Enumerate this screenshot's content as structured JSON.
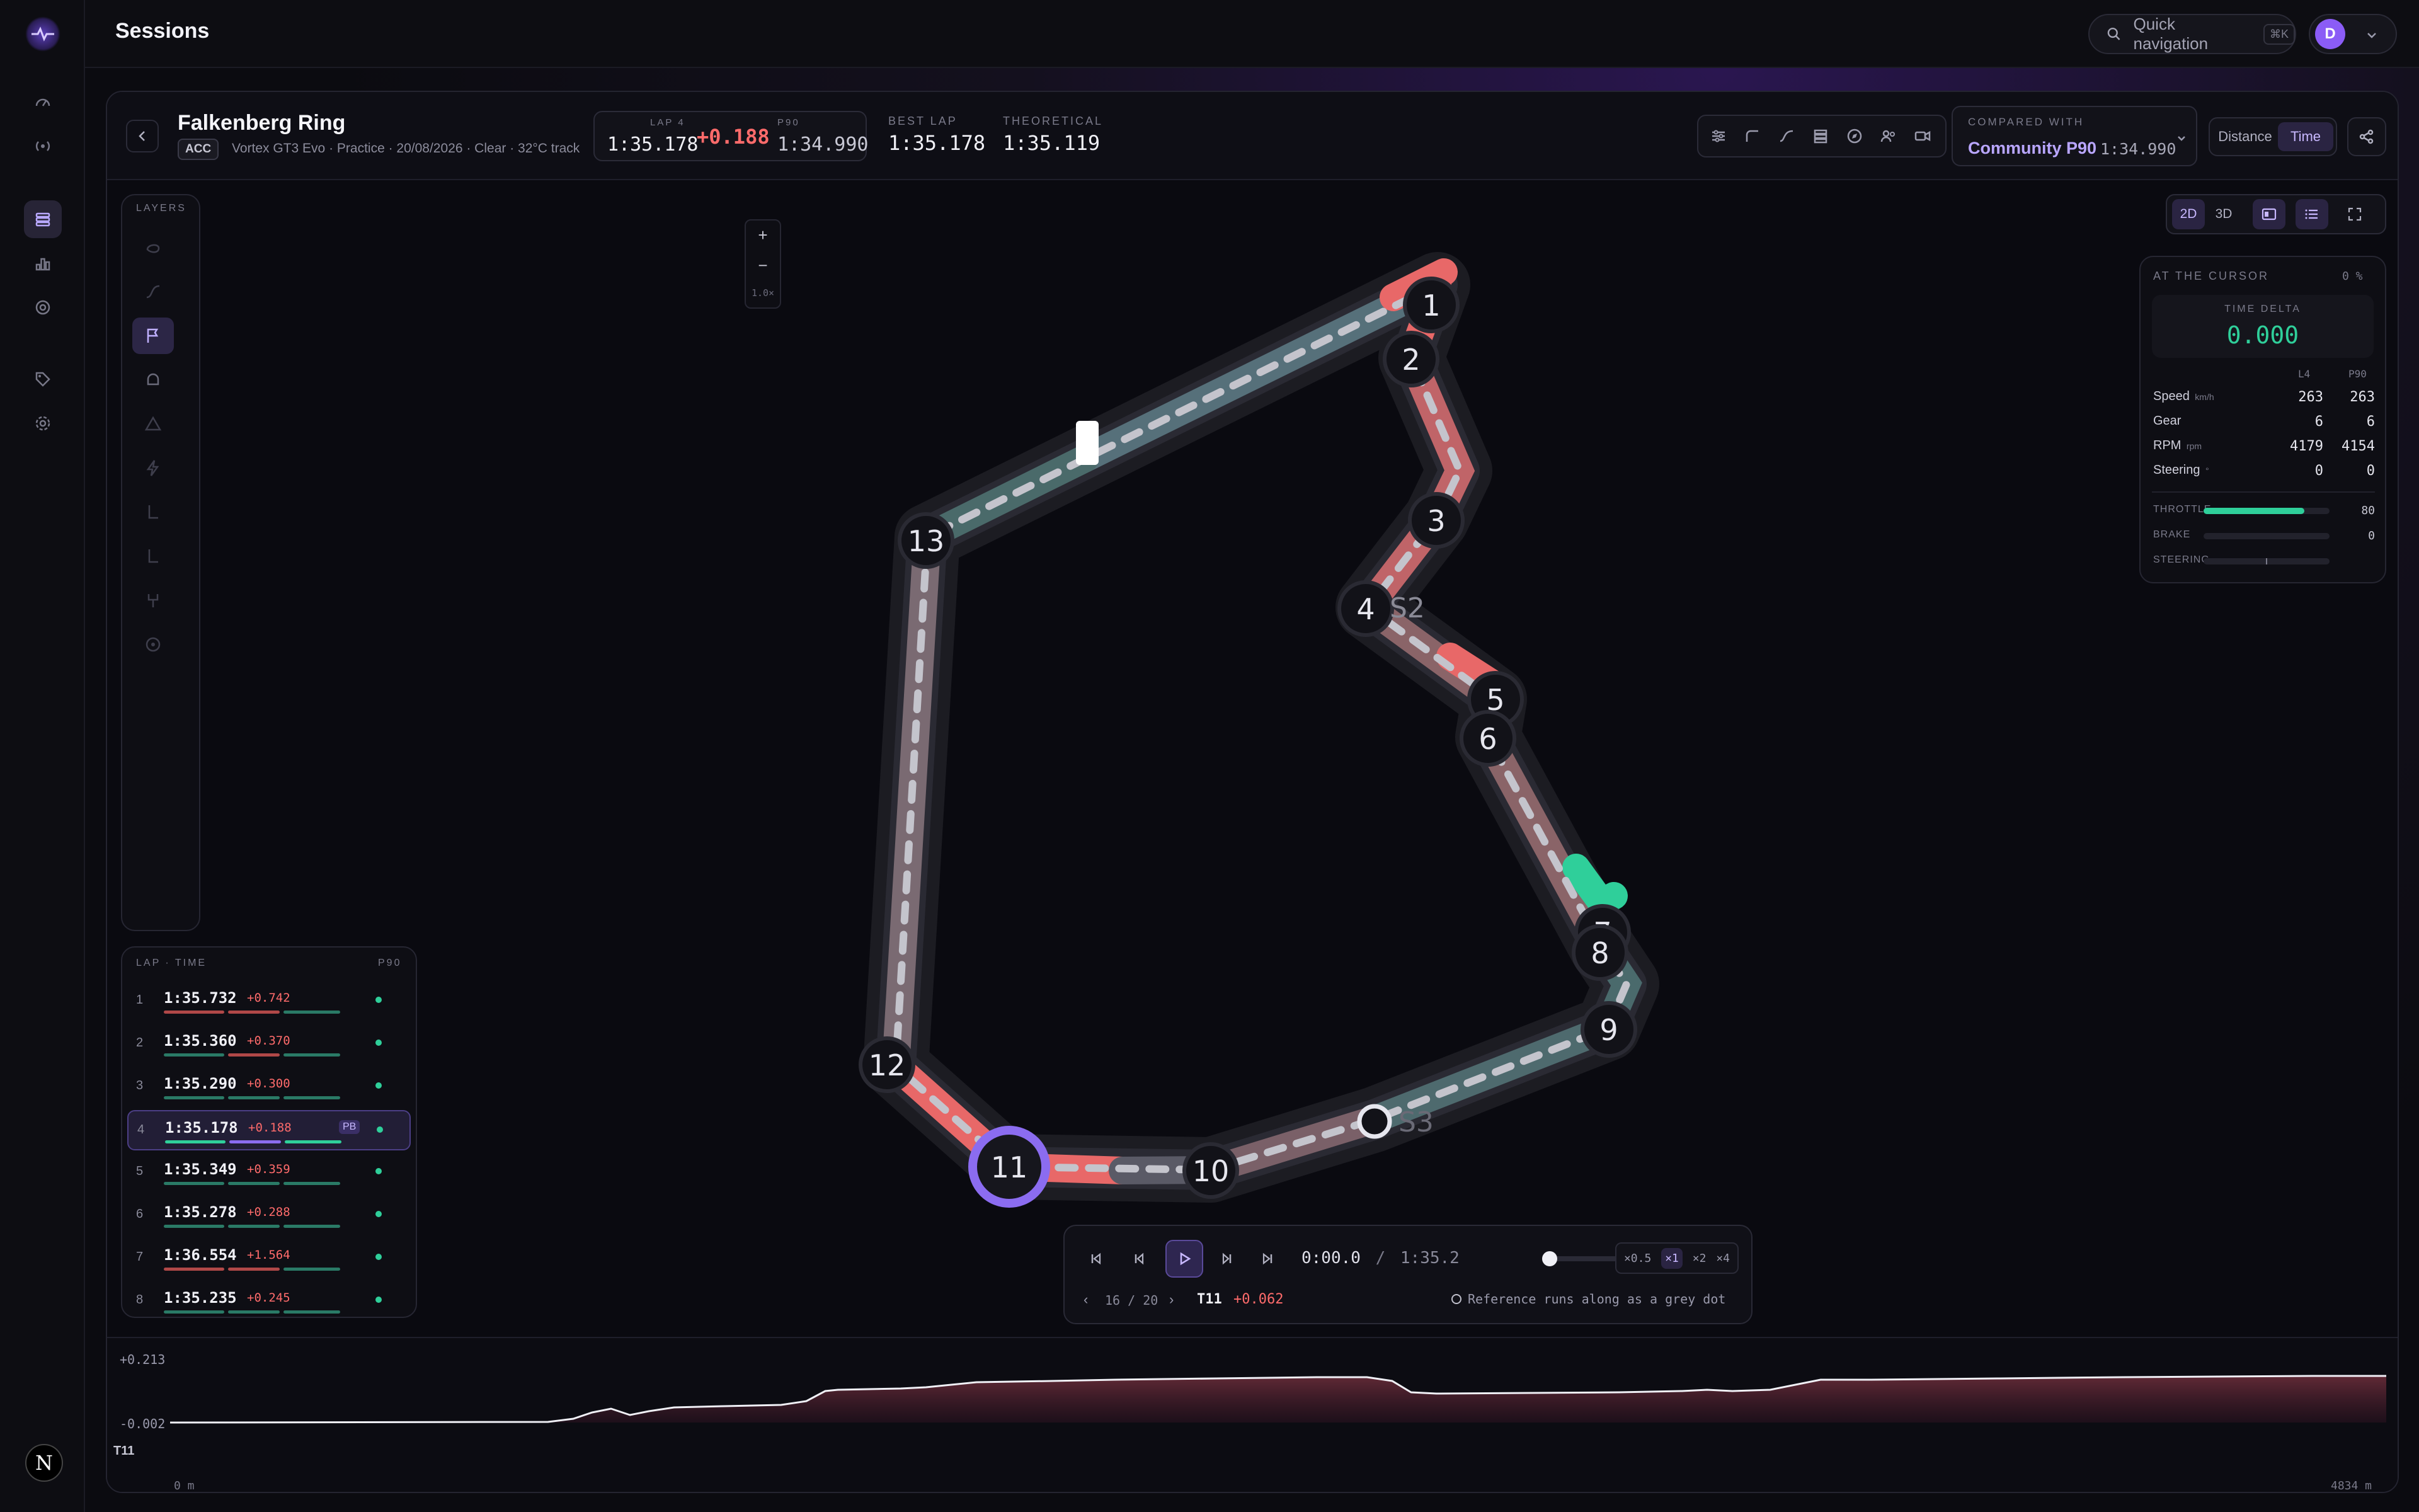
{
  "app": {
    "page_title": "Sessions",
    "quick_nav_label": "Quick navigation",
    "quick_nav_shortcut": "⌘K",
    "avatar_initial": "D"
  },
  "session": {
    "track": "Falkenberg Ring",
    "sim_badge": "ACC",
    "details": "Vortex GT3 Evo · Practice · 20/08/2026 · Clear · 32°C track",
    "lap_label": "LAP 4",
    "lap_time": "1:35.178",
    "lap_delta": "+0.188",
    "ref_label": "P90",
    "ref_time": "1:34.990",
    "best_lap_label": "BEST LAP",
    "best_lap": "1:35.178",
    "theoretical_label": "THEORETICAL",
    "theoretical": "1:35.119"
  },
  "compare": {
    "label": "COMPARED WITH",
    "name": "Community P90",
    "time": "1:34.990"
  },
  "axis_toggle": {
    "distance": "Distance",
    "time": "Time",
    "selected": "Time"
  },
  "view_toggle": {
    "mode_2d": "2D",
    "mode_3d": "3D",
    "selected": "2D"
  },
  "layers": {
    "title": "LAYERS"
  },
  "zoom": {
    "plus": "+",
    "minus": "−",
    "level": "1.0×"
  },
  "track_map": {
    "turns": [
      "1",
      "2",
      "3",
      "4",
      "5",
      "6",
      "7",
      "8",
      "9",
      "10",
      "11",
      "12",
      "13"
    ],
    "sector_labels": [
      "S2",
      "S3"
    ],
    "active_turn": "11"
  },
  "cursor": {
    "title": "AT THE CURSOR",
    "pct": "0 %",
    "delta_label": "TIME DELTA",
    "delta": "0.000",
    "col_a": "L4",
    "col_b": "P90",
    "rows": [
      {
        "label": "Speed",
        "unit": "km/h",
        "a": "263",
        "b": "263"
      },
      {
        "label": "Gear",
        "unit": "",
        "a": "6",
        "b": "6"
      },
      {
        "label": "RPM",
        "unit": "rpm",
        "a": "4179",
        "b": "4154"
      },
      {
        "label": "Steering",
        "unit": "°",
        "a": "0",
        "b": "0"
      }
    ],
    "bars": [
      {
        "label": "THROTTLE",
        "value": "80",
        "fill": 0.8
      },
      {
        "label": "BRAKE",
        "value": "0",
        "fill": 0
      },
      {
        "label": "STEERING",
        "value": "",
        "fill": 0
      }
    ]
  },
  "laps": {
    "header_left": "LAP · TIME",
    "header_right": "P90",
    "rows": [
      {
        "n": "1",
        "time": "1:35.732",
        "delta": "+0.742",
        "pb": ""
      },
      {
        "n": "2",
        "time": "1:35.360",
        "delta": "+0.370",
        "pb": ""
      },
      {
        "n": "3",
        "time": "1:35.290",
        "delta": "+0.300",
        "pb": ""
      },
      {
        "n": "4",
        "time": "1:35.178",
        "delta": "+0.188",
        "pb": "PB"
      },
      {
        "n": "5",
        "time": "1:35.349",
        "delta": "+0.359",
        "pb": ""
      },
      {
        "n": "6",
        "time": "1:35.278",
        "delta": "+0.288",
        "pb": ""
      },
      {
        "n": "7",
        "time": "1:36.554",
        "delta": "+1.564",
        "pb": ""
      },
      {
        "n": "8",
        "time": "1:35.235",
        "delta": "+0.245",
        "pb": ""
      }
    ],
    "selected": "4"
  },
  "player": {
    "current": "0:00.0",
    "separator": "/",
    "total": "1:35.2",
    "speeds": [
      "×0.5",
      "×1",
      "×2",
      "×4"
    ],
    "active_speed": "×1",
    "step": "16 / 20",
    "turn": "T11",
    "turn_delta": "+0.062",
    "hint": "Reference runs along as a grey dot"
  },
  "delta_chart": {
    "max_label": "+0.213",
    "min_label": "-0.002",
    "row_label": "T11",
    "start": "0 m",
    "end": "4834 m"
  },
  "segments": [
    "T1",
    "T2",
    "T3",
    "T4",
    "T5",
    "T6",
    "T7",
    "T9",
    "T10",
    "T11",
    "T12",
    "T13"
  ],
  "colors": {
    "accent": "#8b6cf0",
    "loss": "#e35a5a",
    "gain": "#2fcf9a"
  }
}
